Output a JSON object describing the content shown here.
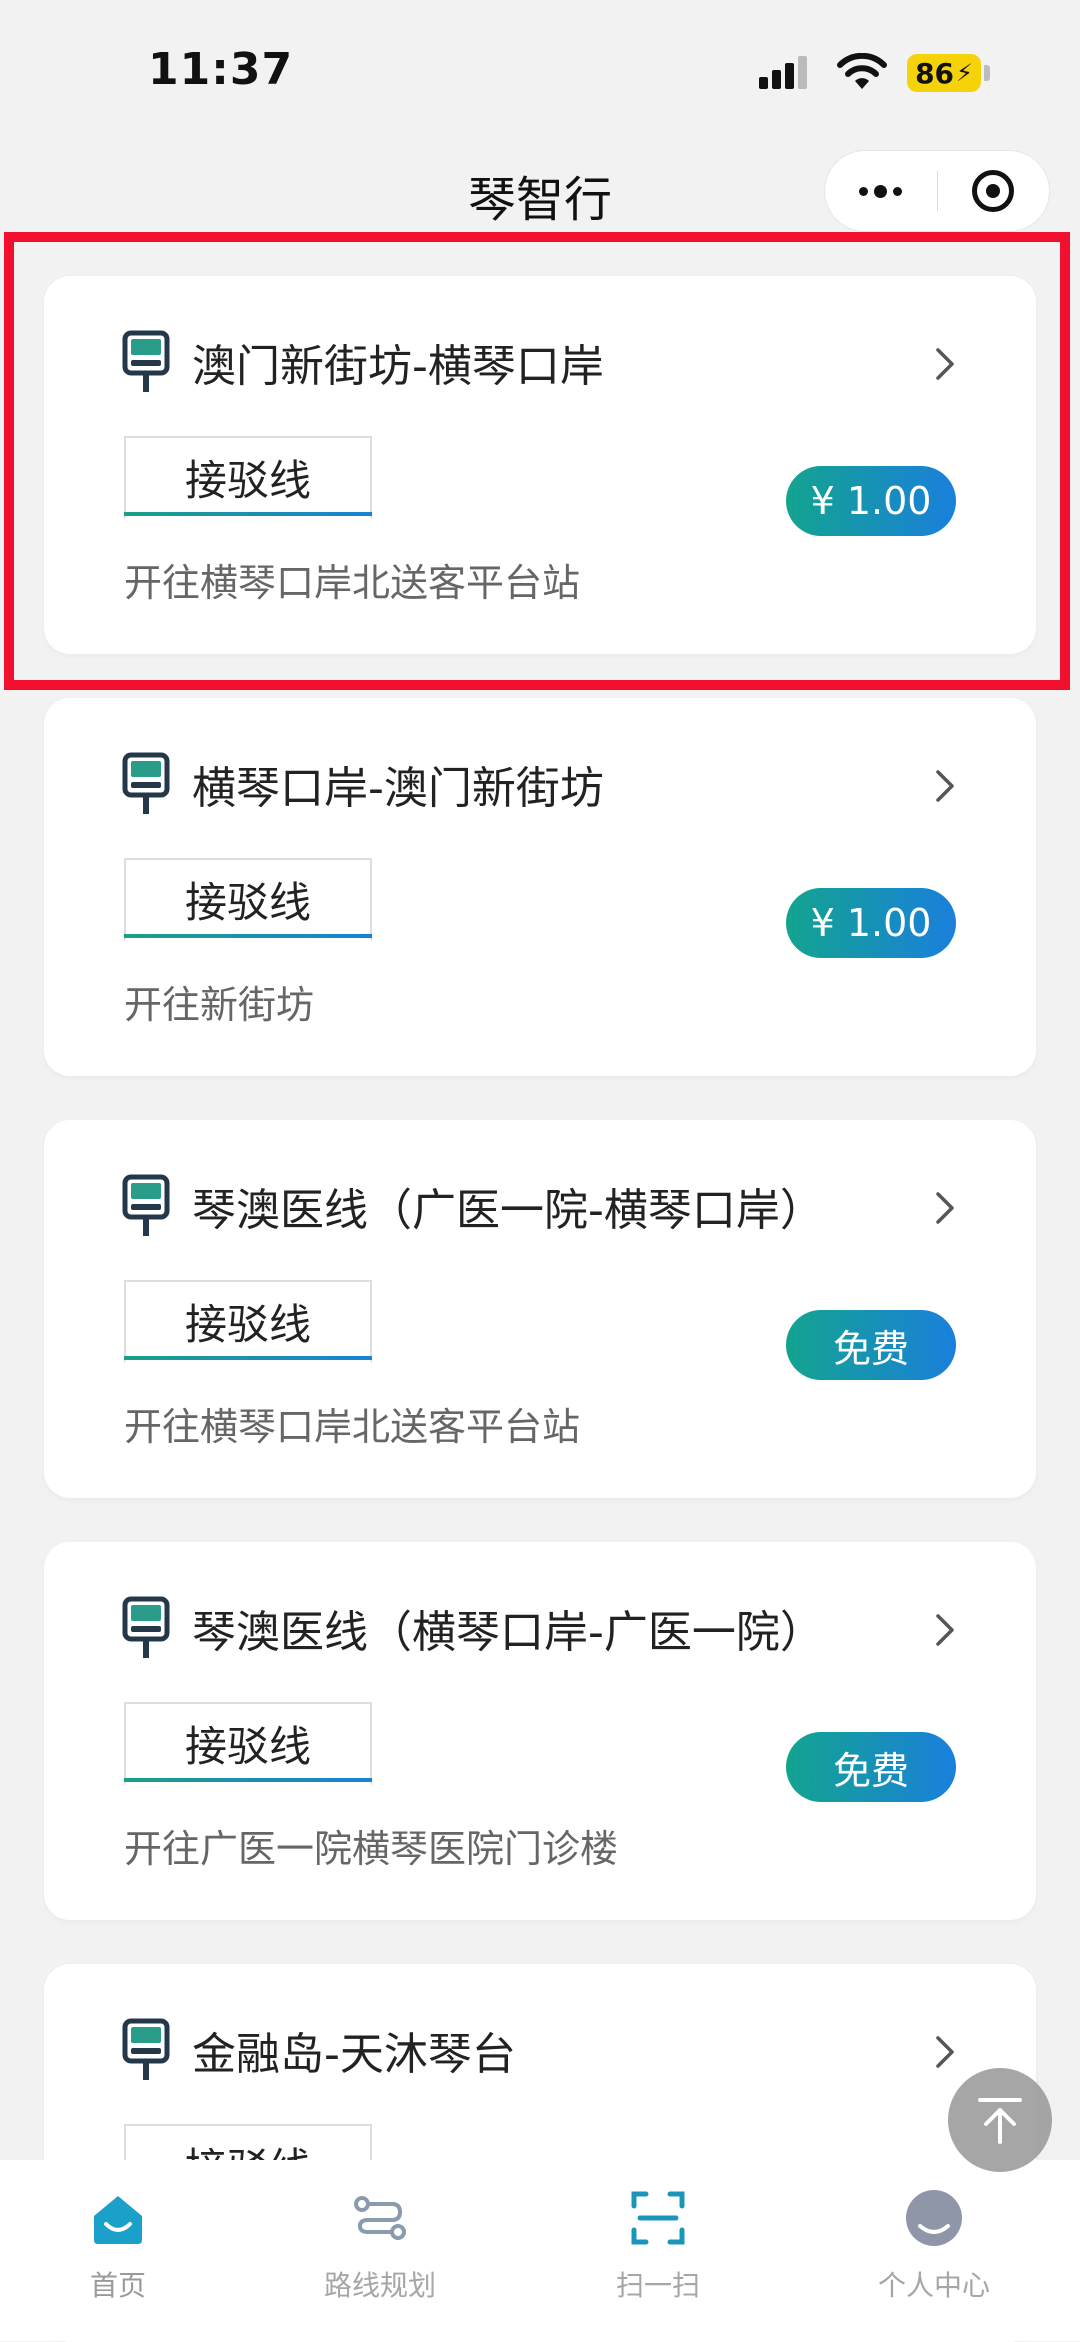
{
  "status_bar": {
    "time": "11:37",
    "battery": "86"
  },
  "nav": {
    "title": "琴智行"
  },
  "routes": [
    {
      "title": "澳门新街坊-横琴口岸",
      "tag": "接驳线",
      "price": "¥ 1.00",
      "desc": "开往横琴口岸北送客平台站",
      "highlighted": true
    },
    {
      "title": "横琴口岸-澳门新街坊",
      "tag": "接驳线",
      "price": "¥ 1.00",
      "desc": "开往新街坊"
    },
    {
      "title": "琴澳医线（广医一院-横琴口岸）",
      "tag": "接驳线",
      "price": "免费",
      "desc": "开往横琴口岸北送客平台站"
    },
    {
      "title": "琴澳医线（横琴口岸-广医一院）",
      "tag": "接驳线",
      "price": "免费",
      "desc": "开往广医一院横琴医院门诊楼"
    },
    {
      "title": "金融岛-天沐琴台",
      "tag": "接驳线",
      "price": "",
      "desc": ""
    }
  ],
  "tab_bar": {
    "items": [
      {
        "label": "首页",
        "icon": "home-icon",
        "active": true
      },
      {
        "label": "路线规划",
        "icon": "route-icon"
      },
      {
        "label": "扫一扫",
        "icon": "scan-icon"
      },
      {
        "label": "个人中心",
        "icon": "user-icon"
      }
    ]
  },
  "colors": {
    "accent_teal": "#13a48f",
    "accent_blue": "#1a7fdc",
    "highlight_red": "#f2102e",
    "battery_yellow": "#f5d20a"
  }
}
